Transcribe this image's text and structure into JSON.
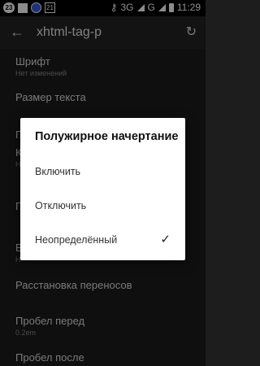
{
  "status_bar": {
    "notif_count": "23",
    "calendar_day": "21",
    "network": "3G",
    "network_g": "G",
    "time": "11:29"
  },
  "app_bar": {
    "title": "xhtml-tag-p"
  },
  "settings": [
    {
      "title": "Шрифт",
      "summary": "Нет изменений"
    },
    {
      "title": "Размер текста",
      "summary": ""
    },
    {
      "title": "П",
      "summary": ""
    },
    {
      "title": "К",
      "summary": "Н"
    },
    {
      "title": "П",
      "summary": ""
    },
    {
      "title": "В",
      "summary": "Н"
    },
    {
      "title": "Расстановка переносов",
      "summary": ""
    },
    {
      "title": "Пробел перед",
      "summary": "0.2em"
    },
    {
      "title": "Пробел после",
      "summary": ""
    }
  ],
  "dialog": {
    "title": "Полужирное начертание",
    "options": [
      {
        "label": "Включить",
        "selected": false
      },
      {
        "label": "Отключить",
        "selected": false
      },
      {
        "label": "Неопределённый",
        "selected": true
      }
    ]
  }
}
